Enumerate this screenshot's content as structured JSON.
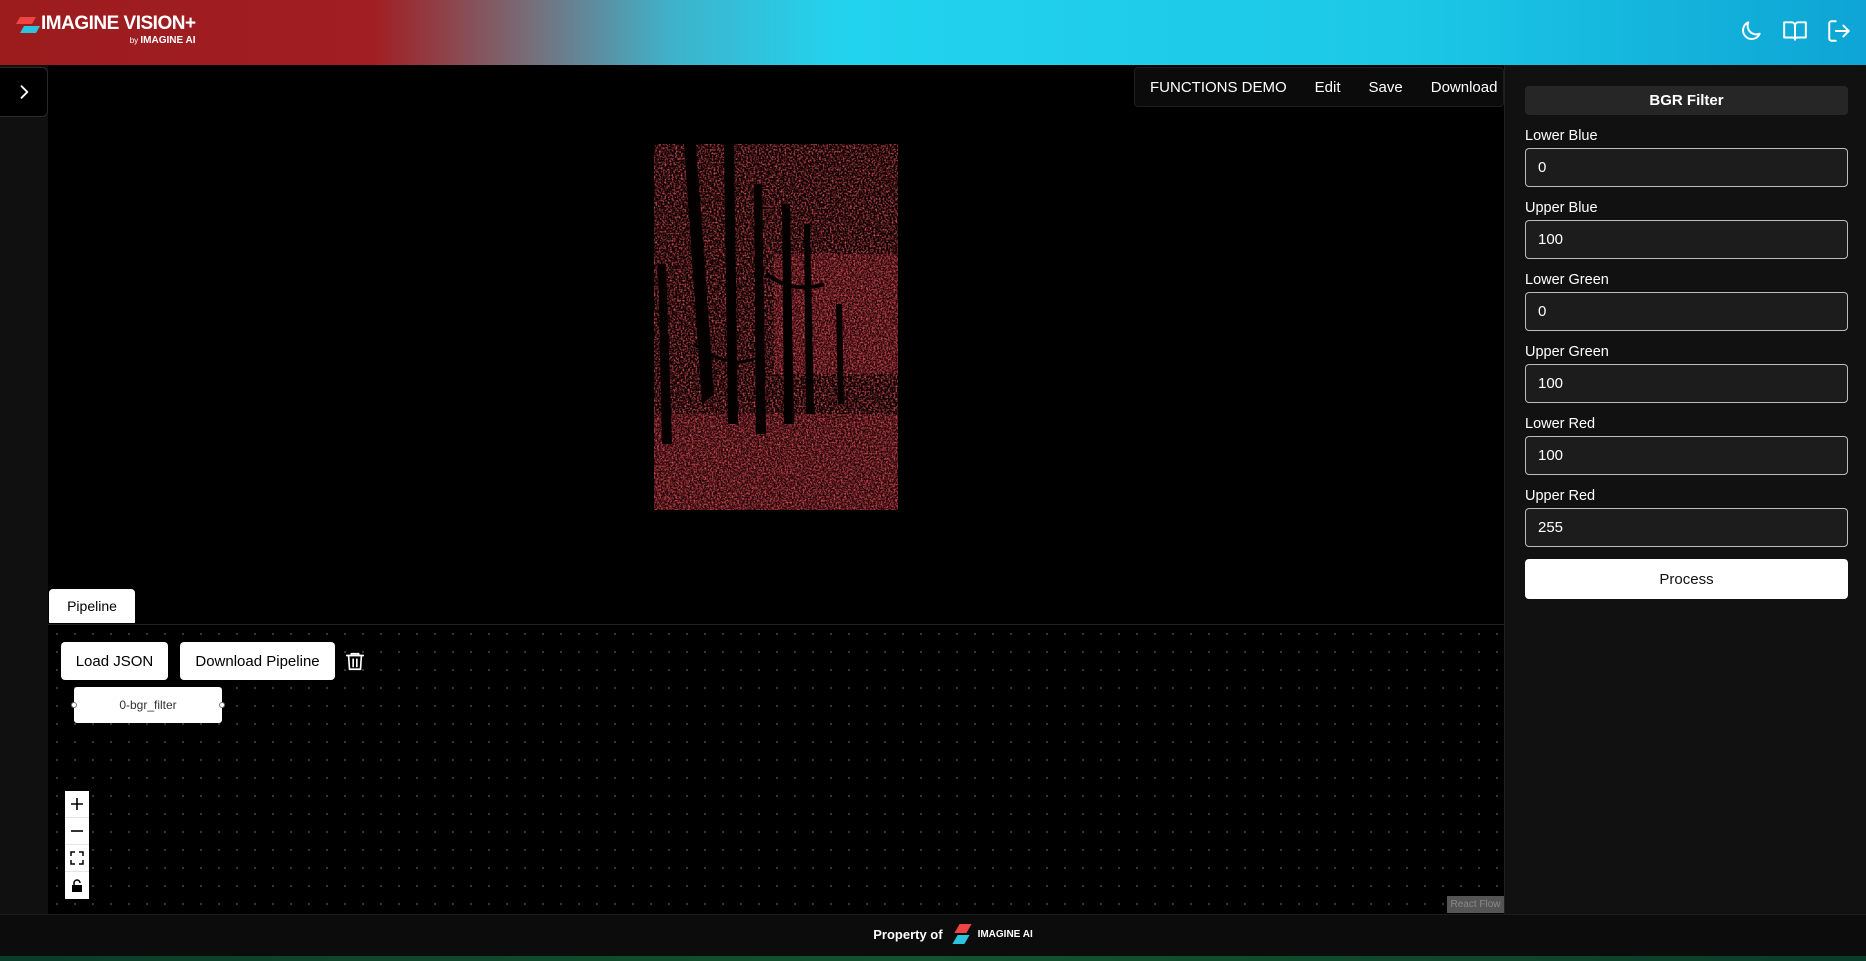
{
  "header": {
    "brand_main": "IMAGINE VISION+",
    "brand_by": "by",
    "brand_sub": "IMAGINE AI",
    "icons": [
      "moon-icon",
      "book-icon",
      "logout-icon"
    ]
  },
  "topmenu": {
    "title": "FUNCTIONS DEMO",
    "edit": "Edit",
    "save": "Save",
    "download": "Download"
  },
  "pipeline": {
    "tab_label": "Pipeline",
    "load_json": "Load JSON",
    "download_pipeline": "Download Pipeline",
    "node_label": "0-bgr_filter",
    "controls": [
      "+",
      "—",
      "⛶",
      "🔒"
    ],
    "attribution": "React Flow"
  },
  "panel": {
    "title": "BGR Filter",
    "fields": [
      {
        "label": "Lower Blue",
        "value": "0"
      },
      {
        "label": "Upper Blue",
        "value": "100"
      },
      {
        "label": "Lower Green",
        "value": "0"
      },
      {
        "label": "Upper Green",
        "value": "100"
      },
      {
        "label": "Lower Red",
        "value": "100"
      },
      {
        "label": "Upper Red",
        "value": "255"
      }
    ],
    "process": "Process"
  },
  "footer": {
    "text": "Property of",
    "logo_text": "IMAGINE AI"
  },
  "colors": {
    "accent_red": "#ef4444",
    "accent_cyan": "#22d3ee"
  }
}
